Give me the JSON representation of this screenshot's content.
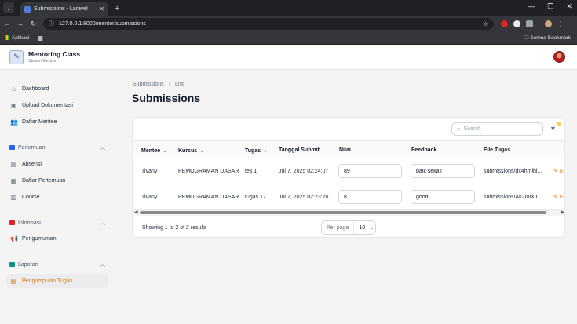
{
  "browser": {
    "tab_title": "Submissions - Laravel",
    "url": "127.0.0.1:8000/mentor/submissions",
    "bookmark_apps": "Aplikasi",
    "bookmark_all": "Semua Bookmark"
  },
  "brand": {
    "name": "Mentoring Class",
    "subtitle": "Sistem Mentor"
  },
  "sidebar": {
    "items": [
      {
        "label": "Dashboard"
      },
      {
        "label": "Upload Dokumentasi"
      },
      {
        "label": "Daftar Mentee"
      }
    ],
    "groups": [
      {
        "label": "Pertemuan",
        "items": [
          {
            "label": "Absensi"
          },
          {
            "label": "Daftar Pertemuan"
          },
          {
            "label": "Course"
          }
        ]
      },
      {
        "label": "Informasi",
        "items": [
          {
            "label": "Pengumuman"
          }
        ]
      },
      {
        "label": "Laporan",
        "items": [
          {
            "label": "Pengumpulan Tugas"
          }
        ]
      }
    ]
  },
  "breadcrumb": {
    "parent": "Submissions",
    "separator": "›",
    "current": "List"
  },
  "page_title": "Submissions",
  "search": {
    "placeholder": "Search"
  },
  "filter": {
    "badge": "0"
  },
  "table": {
    "columns": [
      "Mentee",
      "Kursus",
      "Tugas",
      "Tanggal Submit",
      "Nilai",
      "Feedback",
      "File Tugas"
    ],
    "rows": [
      {
        "mentee": "Tivany",
        "kursus": "PEMOGRAMAN DASAR",
        "tugas": "tes 1",
        "tanggal": "Jul 7, 2025 02:24:07",
        "nilai": "89",
        "feedback": "baik sekali",
        "file": "submissions/dx4hmihl...",
        "action": "Ed"
      },
      {
        "mentee": "Tivany",
        "kursus": "PEMOGRAMAN DASAR",
        "tugas": "tugas 17",
        "tanggal": "Jul 7, 2025 02:23:20",
        "nilai": "8",
        "feedback": "good",
        "file": "submissions/Ak2I0IXJ...",
        "action": "Ed"
      }
    ]
  },
  "footer": {
    "showing": "Showing 1 to 2 of 2 results",
    "per_page_label": "Per page",
    "per_page_value": "10"
  },
  "colors": {
    "accent": "#d97706",
    "pertemuan_icon": "#2563eb",
    "informasi_icon": "#dc2626",
    "laporan_icon": "#0d9488"
  }
}
